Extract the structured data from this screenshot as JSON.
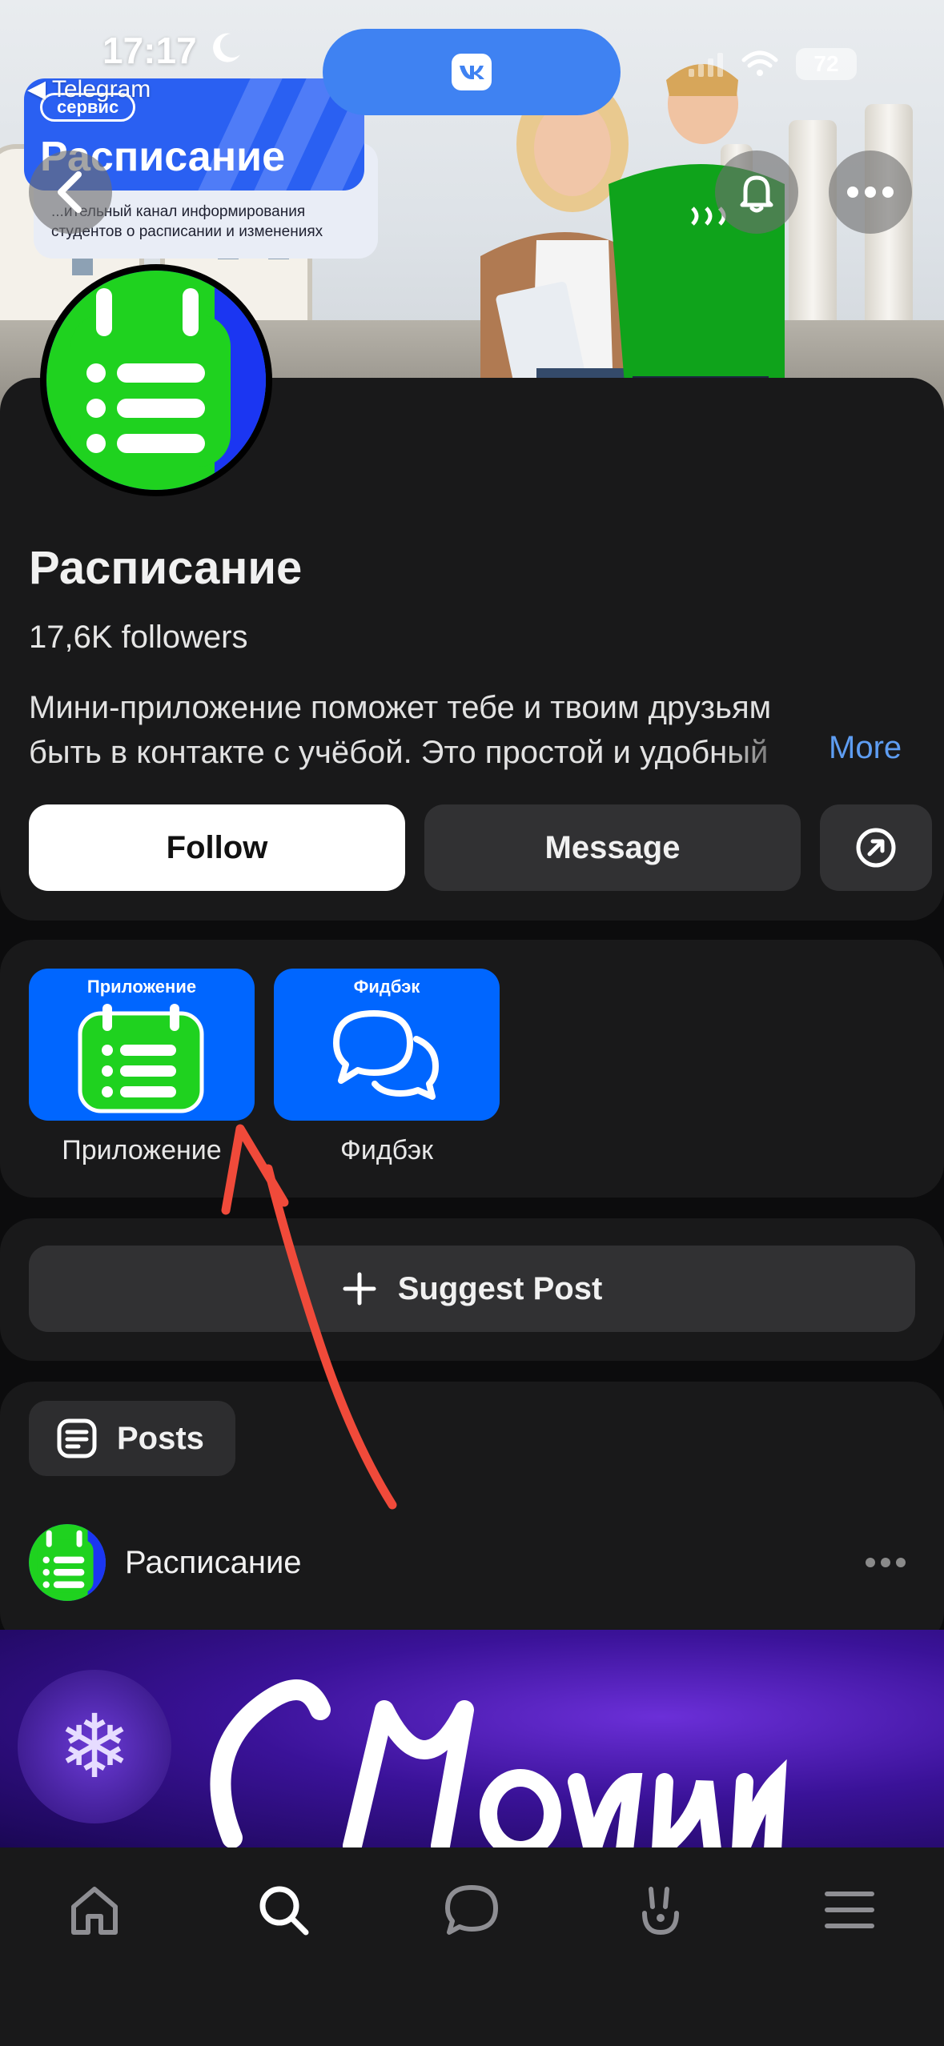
{
  "status_bar": {
    "time": "17:17",
    "back_app": "Telegram",
    "battery": "72"
  },
  "cover": {
    "chip": "сервис",
    "title": "Расписание",
    "subtitle": "...ительный канал информирования студентов о расписании и изменениях"
  },
  "island": {
    "app_icon": "vk-logo"
  },
  "header_actions": {
    "back": "back-icon",
    "bell": "bell-icon",
    "more": "more-icon"
  },
  "profile": {
    "name": "Расписание",
    "followers": "17,6K followers",
    "description_line1": "Мини-приложение поможет тебе и твоим друзьям",
    "description_line2": "быть в контакте с учёбой. Это простой и удобный",
    "more": "More",
    "follow": "Follow",
    "message": "Message"
  },
  "apps": [
    {
      "tile_title": "Приложение",
      "label": "Приложение"
    },
    {
      "tile_title": "Фидбэк",
      "label": "Фидбэк"
    }
  ],
  "suggest": {
    "label": "Suggest Post"
  },
  "posts": {
    "tab": "Posts",
    "author": "Расписание"
  },
  "tabbar": [
    "home-icon",
    "search-icon",
    "messages-icon",
    "clips-icon",
    "menu-icon"
  ],
  "colors": {
    "accent": "#0066ff",
    "link": "#5e9df2",
    "brand_green": "#1fd21f",
    "annotation": "#f04a3a"
  }
}
